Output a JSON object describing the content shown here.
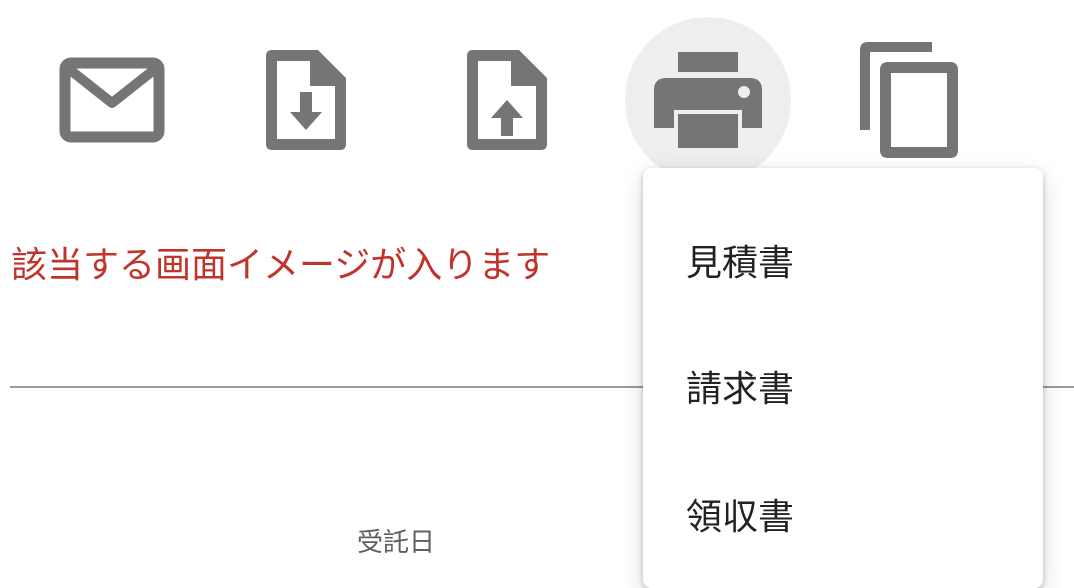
{
  "toolbar": {
    "buttons": [
      {
        "icon": "mail-icon",
        "active": false
      },
      {
        "icon": "file-download-icon",
        "active": false
      },
      {
        "icon": "file-upload-icon",
        "active": false
      },
      {
        "icon": "printer-icon",
        "active": true
      },
      {
        "icon": "copy-icon",
        "active": false
      }
    ],
    "icon_color": "#757575",
    "active_bg": "#eeeeee"
  },
  "main": {
    "placeholder_text": "該当する画面イメージが入ります",
    "placeholder_color": "#c0342b",
    "field_label": "受託日"
  },
  "print_menu": {
    "items": [
      {
        "label": "見積書"
      },
      {
        "label": "請求書"
      },
      {
        "label": "領収書"
      }
    ]
  }
}
